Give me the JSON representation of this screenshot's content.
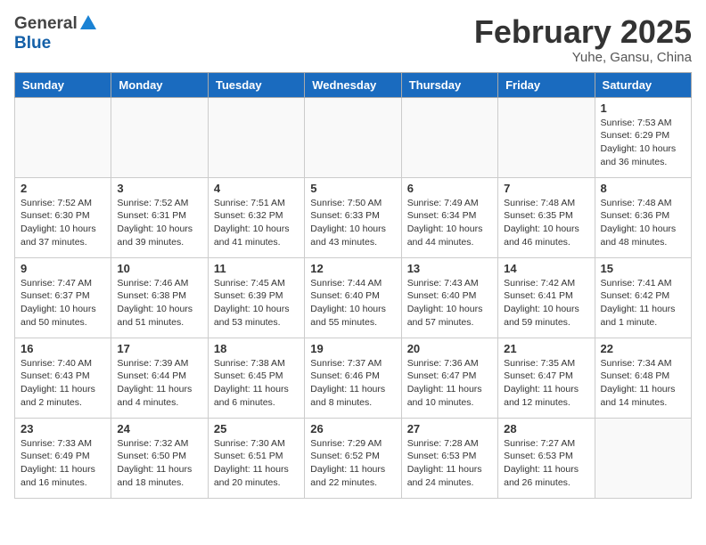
{
  "header": {
    "logo_general": "General",
    "logo_blue": "Blue",
    "title": "February 2025",
    "location": "Yuhe, Gansu, China"
  },
  "days_of_week": [
    "Sunday",
    "Monday",
    "Tuesday",
    "Wednesday",
    "Thursday",
    "Friday",
    "Saturday"
  ],
  "weeks": [
    [
      {
        "day": "",
        "info": ""
      },
      {
        "day": "",
        "info": ""
      },
      {
        "day": "",
        "info": ""
      },
      {
        "day": "",
        "info": ""
      },
      {
        "day": "",
        "info": ""
      },
      {
        "day": "",
        "info": ""
      },
      {
        "day": "1",
        "info": "Sunrise: 7:53 AM\nSunset: 6:29 PM\nDaylight: 10 hours and 36 minutes."
      }
    ],
    [
      {
        "day": "2",
        "info": "Sunrise: 7:52 AM\nSunset: 6:30 PM\nDaylight: 10 hours and 37 minutes."
      },
      {
        "day": "3",
        "info": "Sunrise: 7:52 AM\nSunset: 6:31 PM\nDaylight: 10 hours and 39 minutes."
      },
      {
        "day": "4",
        "info": "Sunrise: 7:51 AM\nSunset: 6:32 PM\nDaylight: 10 hours and 41 minutes."
      },
      {
        "day": "5",
        "info": "Sunrise: 7:50 AM\nSunset: 6:33 PM\nDaylight: 10 hours and 43 minutes."
      },
      {
        "day": "6",
        "info": "Sunrise: 7:49 AM\nSunset: 6:34 PM\nDaylight: 10 hours and 44 minutes."
      },
      {
        "day": "7",
        "info": "Sunrise: 7:48 AM\nSunset: 6:35 PM\nDaylight: 10 hours and 46 minutes."
      },
      {
        "day": "8",
        "info": "Sunrise: 7:48 AM\nSunset: 6:36 PM\nDaylight: 10 hours and 48 minutes."
      }
    ],
    [
      {
        "day": "9",
        "info": "Sunrise: 7:47 AM\nSunset: 6:37 PM\nDaylight: 10 hours and 50 minutes."
      },
      {
        "day": "10",
        "info": "Sunrise: 7:46 AM\nSunset: 6:38 PM\nDaylight: 10 hours and 51 minutes."
      },
      {
        "day": "11",
        "info": "Sunrise: 7:45 AM\nSunset: 6:39 PM\nDaylight: 10 hours and 53 minutes."
      },
      {
        "day": "12",
        "info": "Sunrise: 7:44 AM\nSunset: 6:40 PM\nDaylight: 10 hours and 55 minutes."
      },
      {
        "day": "13",
        "info": "Sunrise: 7:43 AM\nSunset: 6:40 PM\nDaylight: 10 hours and 57 minutes."
      },
      {
        "day": "14",
        "info": "Sunrise: 7:42 AM\nSunset: 6:41 PM\nDaylight: 10 hours and 59 minutes."
      },
      {
        "day": "15",
        "info": "Sunrise: 7:41 AM\nSunset: 6:42 PM\nDaylight: 11 hours and 1 minute."
      }
    ],
    [
      {
        "day": "16",
        "info": "Sunrise: 7:40 AM\nSunset: 6:43 PM\nDaylight: 11 hours and 2 minutes."
      },
      {
        "day": "17",
        "info": "Sunrise: 7:39 AM\nSunset: 6:44 PM\nDaylight: 11 hours and 4 minutes."
      },
      {
        "day": "18",
        "info": "Sunrise: 7:38 AM\nSunset: 6:45 PM\nDaylight: 11 hours and 6 minutes."
      },
      {
        "day": "19",
        "info": "Sunrise: 7:37 AM\nSunset: 6:46 PM\nDaylight: 11 hours and 8 minutes."
      },
      {
        "day": "20",
        "info": "Sunrise: 7:36 AM\nSunset: 6:47 PM\nDaylight: 11 hours and 10 minutes."
      },
      {
        "day": "21",
        "info": "Sunrise: 7:35 AM\nSunset: 6:47 PM\nDaylight: 11 hours and 12 minutes."
      },
      {
        "day": "22",
        "info": "Sunrise: 7:34 AM\nSunset: 6:48 PM\nDaylight: 11 hours and 14 minutes."
      }
    ],
    [
      {
        "day": "23",
        "info": "Sunrise: 7:33 AM\nSunset: 6:49 PM\nDaylight: 11 hours and 16 minutes."
      },
      {
        "day": "24",
        "info": "Sunrise: 7:32 AM\nSunset: 6:50 PM\nDaylight: 11 hours and 18 minutes."
      },
      {
        "day": "25",
        "info": "Sunrise: 7:30 AM\nSunset: 6:51 PM\nDaylight: 11 hours and 20 minutes."
      },
      {
        "day": "26",
        "info": "Sunrise: 7:29 AM\nSunset: 6:52 PM\nDaylight: 11 hours and 22 minutes."
      },
      {
        "day": "27",
        "info": "Sunrise: 7:28 AM\nSunset: 6:53 PM\nDaylight: 11 hours and 24 minutes."
      },
      {
        "day": "28",
        "info": "Sunrise: 7:27 AM\nSunset: 6:53 PM\nDaylight: 11 hours and 26 minutes."
      },
      {
        "day": "",
        "info": ""
      }
    ]
  ]
}
